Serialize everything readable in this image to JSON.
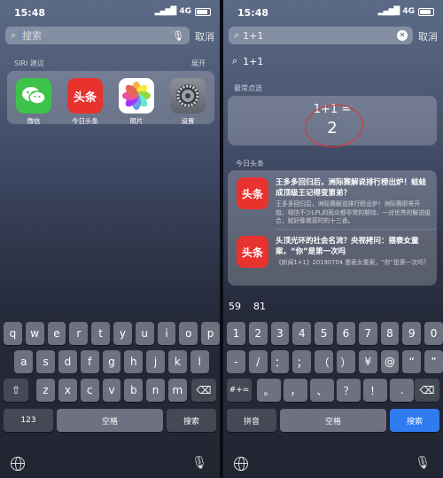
{
  "left": {
    "status": {
      "time": "15:48",
      "network": "4G"
    },
    "search": {
      "placeholder": "搜索",
      "cancel": "取消"
    },
    "siri": {
      "label": "SIRI 建议",
      "expand": "展开",
      "apps": [
        {
          "label": "微信",
          "icon": "wechat-icon"
        },
        {
          "label": "今日头条",
          "icon": "toutiao-icon",
          "glyph": "头条"
        },
        {
          "label": "照片",
          "icon": "photos-icon"
        },
        {
          "label": "设置",
          "icon": "settings-icon"
        }
      ]
    },
    "keyboard": {
      "row1": [
        "q",
        "w",
        "e",
        "r",
        "t",
        "y",
        "u",
        "i",
        "o",
        "p"
      ],
      "row2": [
        "a",
        "s",
        "d",
        "f",
        "g",
        "h",
        "j",
        "k",
        "l"
      ],
      "row3": [
        "z",
        "x",
        "c",
        "v",
        "b",
        "n",
        "m"
      ],
      "num_key": "123",
      "space": "空格",
      "search": "搜索"
    }
  },
  "right": {
    "status": {
      "time": "15:48",
      "network": "4G"
    },
    "search": {
      "value": "1+1",
      "cancel": "取消"
    },
    "suggestion": "1+1",
    "top_hit_label": "最常点选",
    "calc": {
      "expression": "1+1 =",
      "result": "2"
    },
    "news_label": "今日头条",
    "news": [
      {
        "glyph": "头条",
        "title": "王多多回归后，洲际赛解说排行榜出炉！蛙蛙成顶级王记得变第弟？",
        "desc": "王多多回归后，洲际赛解说排行榜出炉！洲际赛即将开始，相信不少LPL的观众都非常的期待，一对优秀的解说组合，就好像做菜时的十三香。"
      },
      {
        "glyph": "头条",
        "title": "头顶光环的社会名流？央视拷问：猥亵女童案，“你”是第一次吗",
        "desc": "《新闻1+1》20190704 猥亵女童案，“你”是第一次吗？"
      }
    ],
    "predictions": [
      "59",
      "81"
    ],
    "keyboard": {
      "row1": [
        "1",
        "2",
        "3",
        "4",
        "5",
        "6",
        "7",
        "8",
        "9",
        "0"
      ],
      "row2": [
        "-",
        "/",
        "：",
        "；",
        "（",
        "）",
        "¥",
        "@",
        "“",
        "”"
      ],
      "row3": [
        "。",
        "，",
        "、",
        "？",
        "！",
        "."
      ],
      "sym_key": "#+=",
      "pinyin": "拼音",
      "space": "空格",
      "search": "搜索"
    }
  }
}
